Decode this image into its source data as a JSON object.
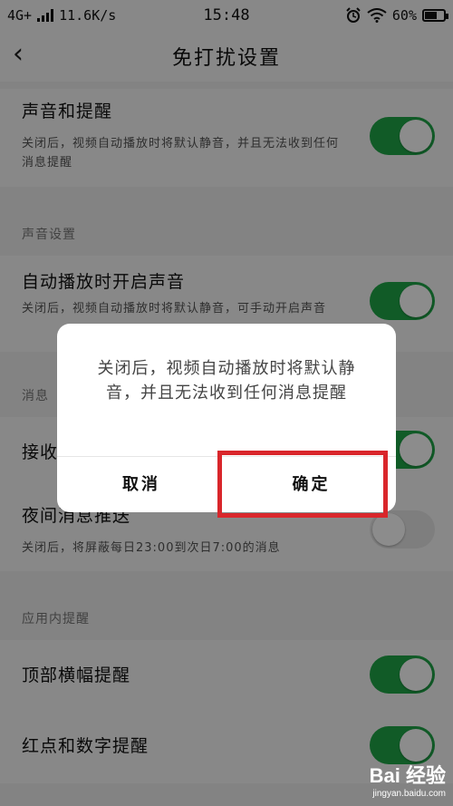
{
  "status_bar": {
    "network": "4G+",
    "speed": "11.6K/s",
    "time": "15:48",
    "battery_percent": "60%",
    "battery_level": 0.6,
    "icons": [
      "signal-bars-icon",
      "alarm-icon",
      "wifi-icon",
      "battery-icon"
    ]
  },
  "header": {
    "back_icon": "‹",
    "title": "免打扰设置"
  },
  "settings": {
    "sound_reminder": {
      "title": "声音和提醒",
      "desc": "关闭后，视频自动播放时将默认静音，并且无法收到任何消息提醒",
      "enabled": true
    },
    "sound_section_label": "声音设置",
    "autoplay_sound": {
      "title": "自动播放时开启声音",
      "desc": "关闭后，视频自动播放时将默认静音，可手动开启声音",
      "enabled": true
    },
    "message_section_label": "消息",
    "receive": {
      "title": "接收",
      "enabled": true
    },
    "night_push": {
      "title": "夜间消息推送",
      "desc": "关闭后，将屏蔽每日23:00到次日7:00的消息",
      "enabled": false
    },
    "inapp_section_label": "应用内提醒",
    "top_banner": {
      "title": "顶部横幅提醒",
      "enabled": true
    },
    "red_dot": {
      "title": "红点和数字提醒",
      "enabled": true
    }
  },
  "dialog": {
    "message": "关闭后，视频自动播放时将默认静音，并且无法收到任何消息提醒",
    "cancel_label": "取消",
    "confirm_label": "确定"
  },
  "watermark": {
    "brand": "Bai 经验",
    "url": "jingyan.baidu.com"
  },
  "colors": {
    "toggle_on": "#1fa748",
    "toggle_off": "#e5e5e5",
    "highlight": "#d9262b"
  }
}
